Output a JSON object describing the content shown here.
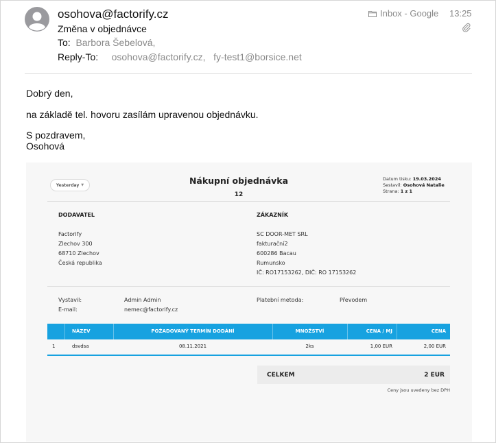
{
  "header": {
    "from": "osohova@factorify.cz",
    "subject": "Změna v objednávce",
    "to_label": "To:",
    "to_value": "Barbora Šebelová,",
    "reply_label": "Reply-To:",
    "reply_1": "osohova@factorify.cz,",
    "reply_2": "fy-test1@borsice.net",
    "mailbox": "Inbox - Google",
    "time": "13:25"
  },
  "icons": {
    "avatar": "person-avatar-icon",
    "mailbox": "folder-icon",
    "attachment": "paperclip-icon"
  },
  "body": {
    "greeting": "Dobrý den,",
    "line": "na základě tel. hovoru zasílám upravenou objednávku.",
    "closing": "S pozdravem,",
    "signature": "Osohová"
  },
  "document": {
    "filter_button": "Yesterday",
    "title": "Nákupní objednávka",
    "number": "12",
    "meta": {
      "print_date_label": "Datum tisku:",
      "print_date": "19.03.2024",
      "author_label": "Sestavil:",
      "author": "Osohová Natalie",
      "page_label": "Strana:",
      "page": "1 z 1"
    },
    "supplier": {
      "heading": "DODAVATEL",
      "lines": [
        "Factorify",
        "Zlechov 300",
        "68710 Zlechov",
        "Česká republika"
      ]
    },
    "customer": {
      "heading": "ZÁKAZNÍK",
      "lines": [
        "SC DOOR-MET SRL",
        "fakturační2",
        "600286 Bacau",
        "Rumunsko",
        "IČ: RO17153262, DIČ: RO 17153262"
      ]
    },
    "issued_by_label": "Vystavil:",
    "issued_by": "Admin Admin",
    "email_label": "E-mail:",
    "email": "nemec@factorify.cz",
    "payment_label": "Platební metoda:",
    "payment": "Převodem",
    "table": {
      "headers": [
        "NÁZEV",
        "POŽADOVANÝ TERMÍN DODÁNÍ",
        "MNOŽSTVÍ",
        "CENA / MJ",
        "CENA"
      ],
      "rows": [
        {
          "index": "1",
          "name": "dsvdsa",
          "date": "08.11.2021",
          "qty": "2ks",
          "unit_price": "1,00 EUR",
          "price": "2,00 EUR"
        }
      ]
    },
    "total_label": "CELKEM",
    "total_value": "2 EUR",
    "note": "Ceny jsou uvedeny bez DPH"
  },
  "colors": {
    "accent": "#17a2e0",
    "muted_text": "#8a8a8a"
  }
}
